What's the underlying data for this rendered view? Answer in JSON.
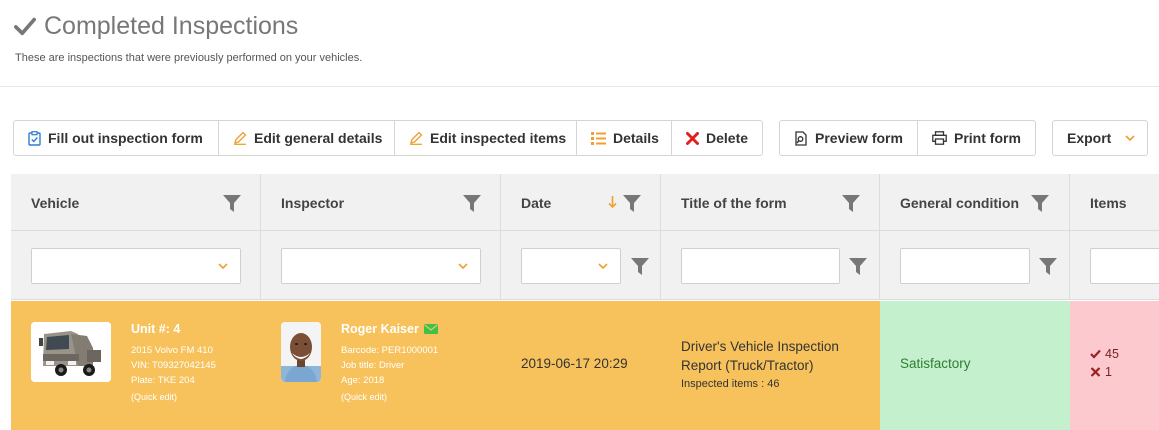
{
  "page": {
    "title": "Completed Inspections",
    "subtitle": "These are inspections that were previously performed on your vehicles.",
    "title_icon": "checkmark-icon"
  },
  "toolbar": {
    "fill_out": "Fill out inspection form",
    "edit_general": "Edit general details",
    "edit_items": "Edit inspected items",
    "details": "Details",
    "delete": "Delete",
    "preview": "Preview form",
    "print": "Print form",
    "export": "Export"
  },
  "columns": {
    "vehicle": "Vehicle",
    "inspector": "Inspector",
    "date": "Date",
    "title": "Title of the form",
    "condition": "General condition",
    "items": "Items"
  },
  "row": {
    "vehicle": {
      "unit": "Unit #: 4",
      "model": "2015 Volvo FM 410",
      "vin": "VIN: T09327042145",
      "plate": "Plate: TKE 204",
      "quick_edit": "(Quick edit)"
    },
    "inspector": {
      "name": "Roger Kaiser",
      "barcode": "Barcode: PER1000001",
      "job": "Job title: Driver",
      "age": "Age: 2018",
      "quick_edit": "(Quick edit)"
    },
    "date": "2019-06-17 20:29",
    "form_title_line1": "Driver's Vehicle Inspection",
    "form_title_line2": "Report (Truck/Tractor)",
    "inspected_items": "Inspected items : 46",
    "condition": "Satisfactory",
    "items_ok": "45",
    "items_bad": "1"
  },
  "colors": {
    "row_highlight": "#f7c25c",
    "condition_bg": "#c4f0cd",
    "items_bg": "#fcc9cf",
    "accent": "#f0a030",
    "delete_red": "#e02020",
    "email_green": "#3cc24a"
  }
}
